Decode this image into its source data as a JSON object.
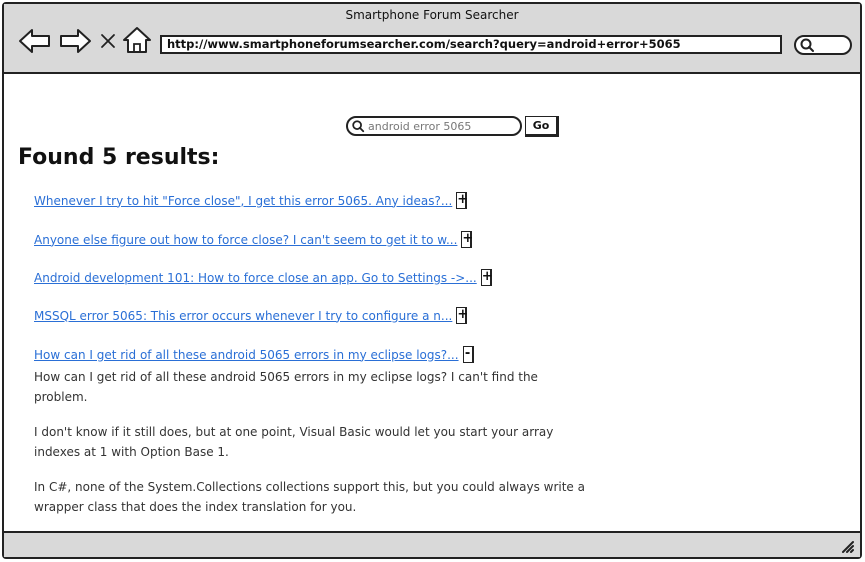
{
  "window": {
    "title": "Smartphone Forum Searcher"
  },
  "browser": {
    "url": "http://www.smartphoneforumsearcher.com/search?query=android+error+5065",
    "nav_icons": [
      "back-arrow-icon",
      "forward-arrow-icon",
      "close-x-icon",
      "home-icon"
    ]
  },
  "search": {
    "query": "android error 5065",
    "go_label": "Go"
  },
  "results": {
    "heading": "Found 5 results:",
    "items": [
      {
        "title": "Whenever I try to hit \"Force close\", I get this error 5065.  Any ideas?...",
        "toggle": "+"
      },
      {
        "title": "Anyone else figure out how to force close?  I can't seem to get it to w...",
        "toggle": "+"
      },
      {
        "title": "Android development 101: How to force close an app.  Go to Settings ->...",
        "toggle": "+"
      },
      {
        "title": "MSSQL error 5065: This error occurs whenever I try to configure a n...",
        "toggle": "+"
      },
      {
        "title": "How can I get rid of all these android 5065 errors in my eclipse logs?...",
        "toggle": "-"
      }
    ],
    "expanded_paragraphs": [
      "How can I get rid of all these android 5065 errors in my eclipse logs?  I can't find the problem.",
      "I don't know if it still does, but at one point, Visual Basic would let you start your array indexes at 1 with Option Base 1.",
      "In C#, none of the System.Collections collections support this, but you could always write a wrapper class that does the index translation for you."
    ]
  }
}
